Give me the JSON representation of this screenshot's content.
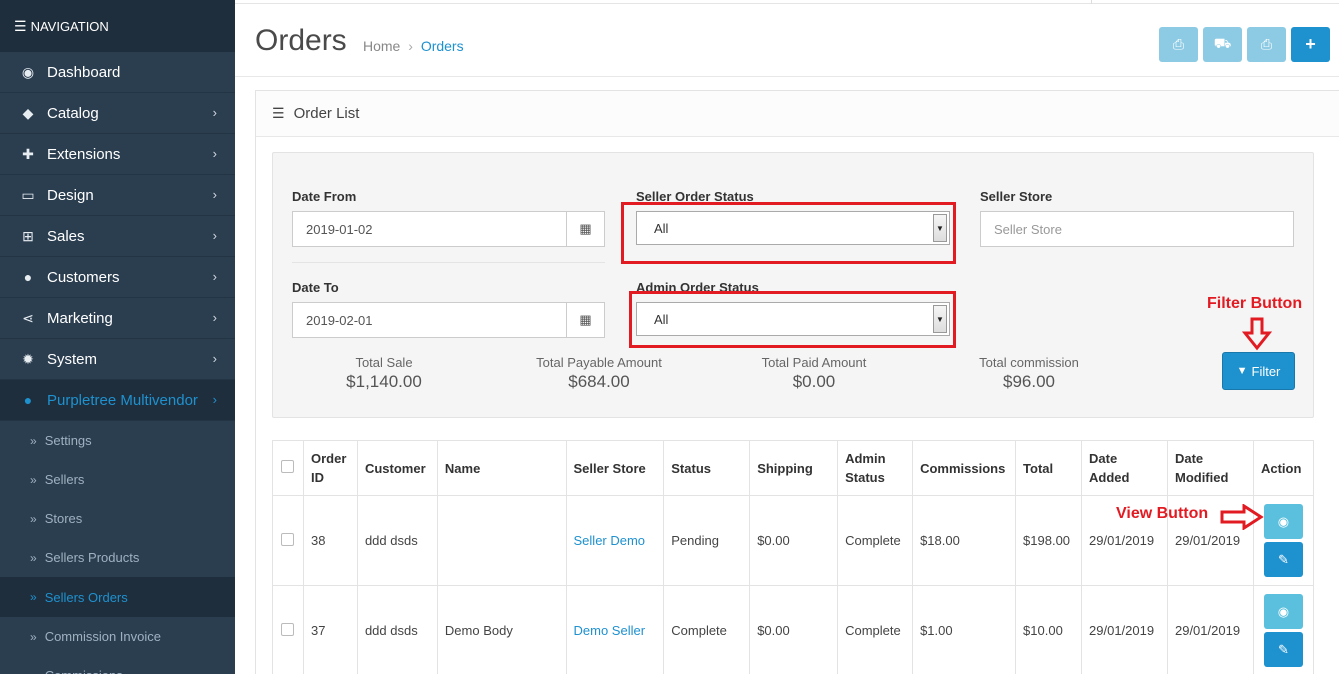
{
  "nav": {
    "header": "NAVIGATION",
    "items": [
      {
        "label": "Dashboard",
        "icon": "dashboard-icon",
        "glyph": "◉",
        "chevron": false
      },
      {
        "label": "Catalog",
        "icon": "tag-icon",
        "glyph": "◆",
        "chevron": true
      },
      {
        "label": "Extensions",
        "icon": "puzzle-icon",
        "glyph": "✚",
        "chevron": true
      },
      {
        "label": "Design",
        "icon": "monitor-icon",
        "glyph": "▭",
        "chevron": true
      },
      {
        "label": "Sales",
        "icon": "cart-icon",
        "glyph": "⊞",
        "chevron": true
      },
      {
        "label": "Customers",
        "icon": "user-icon",
        "glyph": "●",
        "chevron": true
      },
      {
        "label": "Marketing",
        "icon": "share-icon",
        "glyph": "⋖",
        "chevron": true
      },
      {
        "label": "System",
        "icon": "gear-icon",
        "glyph": "✹",
        "chevron": true
      },
      {
        "label": "Purpletree Multivendor",
        "icon": "user-icon",
        "glyph": "●",
        "chevron": true,
        "active": true
      }
    ],
    "sub_items": [
      {
        "label": "Settings"
      },
      {
        "label": "Sellers"
      },
      {
        "label": "Stores"
      },
      {
        "label": "Sellers Products"
      },
      {
        "label": "Sellers Orders",
        "active": true
      },
      {
        "label": "Commission Invoice"
      },
      {
        "label": "Commissions"
      }
    ]
  },
  "header": {
    "title": "Orders",
    "breadcrumb": {
      "home": "Home",
      "sep": "›",
      "current": "Orders"
    },
    "buttons": [
      {
        "name": "print-invoice-button",
        "icon": "print-icon",
        "glyph": "⎙"
      },
      {
        "name": "print-shipping-button",
        "icon": "truck-icon",
        "glyph": "⛟"
      },
      {
        "name": "print-list-button",
        "icon": "print-icon",
        "glyph": "⎙"
      },
      {
        "name": "add-order-button",
        "icon": "plus-icon",
        "glyph": "+"
      }
    ]
  },
  "panel": {
    "title": "Order List",
    "icon": "list-icon"
  },
  "filter": {
    "date_from_label": "Date From",
    "date_from_value": "2019-01-02",
    "date_to_label": "Date To",
    "date_to_value": "2019-02-01",
    "seller_order_status_label": "Seller Order Status",
    "seller_order_status_value": "All",
    "admin_order_status_label": "Admin Order Status",
    "admin_order_status_value": "All",
    "seller_store_label": "Seller Store",
    "seller_store_placeholder": "Seller Store",
    "filter_button_label": "Filter",
    "filter_icon": "filter-icon",
    "calendar_icon": "calendar-icon",
    "highlight_color": "#e21b23"
  },
  "summary": [
    {
      "label": "Total Sale",
      "value": "$1,140.00"
    },
    {
      "label": "Total Payable Amount",
      "value": "$684.00"
    },
    {
      "label": "Total Paid Amount",
      "value": "$0.00"
    },
    {
      "label": "Total commission",
      "value": "$96.00"
    }
  ],
  "annotations": {
    "filter_button": "Filter Button",
    "view_button": "View Button"
  },
  "table": {
    "columns": [
      "Order ID",
      "Customer",
      "Name",
      "Seller Store",
      "Status",
      "Shipping",
      "Admin Status",
      "Commissions",
      "Total",
      "Date Added",
      "Date Modified",
      "Action"
    ],
    "rows": [
      {
        "order_id": "38",
        "customer": "ddd dsds",
        "name": "",
        "seller_store": "Seller Demo",
        "status": "Pending",
        "shipping": "$0.00",
        "admin_status": "Complete",
        "commissions": "$18.00",
        "total": "$198.00",
        "date_added": "29/01/2019",
        "date_modified": "29/01/2019"
      },
      {
        "order_id": "37",
        "customer": "ddd dsds",
        "name": "Demo Body",
        "seller_store": "Demo Seller",
        "status": "Complete",
        "shipping": "$0.00",
        "admin_status": "Complete",
        "commissions": "$1.00",
        "total": "$10.00",
        "date_added": "29/01/2019",
        "date_modified": "29/01/2019"
      }
    ]
  },
  "colors": {
    "primary": "#1e91cf",
    "sidebar": "#2b3e50",
    "annotation_red": "#e21b23"
  }
}
